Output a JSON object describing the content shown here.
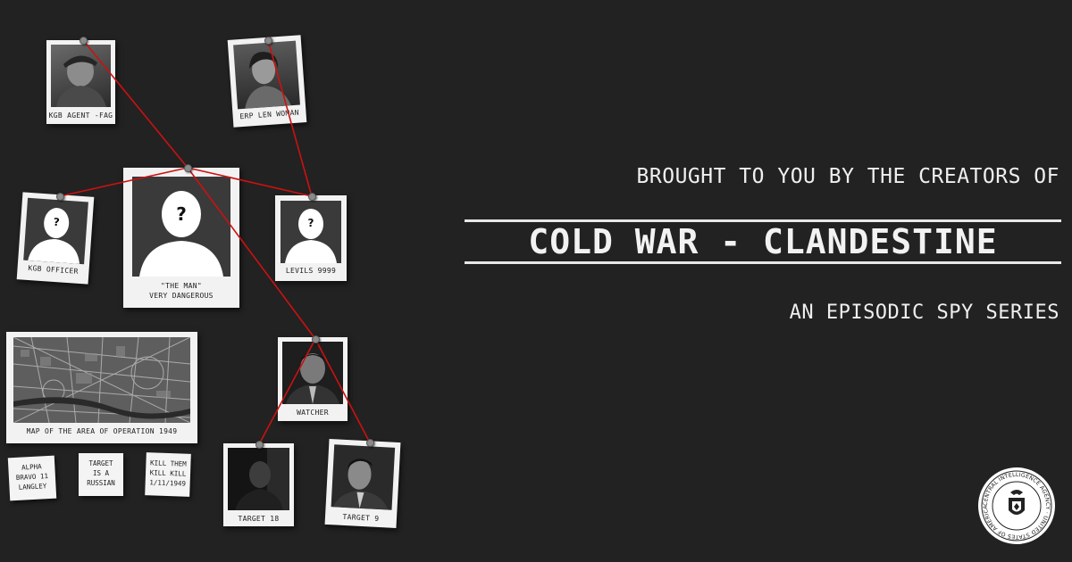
{
  "header": {
    "tagline": "BROUGHT TO YOU BY THE CREATORS OF",
    "title": "COLD WAR - CLANDESTINE",
    "subtitle": "AN EPISODIC SPY SERIES"
  },
  "board": {
    "photos": [
      {
        "id": "kgb-agent",
        "caption": "KGB AGENT -FAG"
      },
      {
        "id": "erp-len",
        "caption": "ERP LEN WOMAN"
      },
      {
        "id": "the-man",
        "caption_line1": "\"THE MAN\"",
        "caption_line2": "VERY DANGEROUS"
      },
      {
        "id": "kgb-officer",
        "caption": "KGB OFFICER"
      },
      {
        "id": "levels",
        "caption": "LEVILS 9999"
      },
      {
        "id": "map",
        "caption": "MAP OF THE AREA OF OPERATION 1949"
      },
      {
        "id": "watcher",
        "caption": "WATCHER"
      },
      {
        "id": "target-18",
        "caption": "TARGET 18"
      },
      {
        "id": "target-9",
        "caption": "TARGET 9"
      }
    ],
    "notes": [
      {
        "line1": "ALPHA",
        "line2": "BRAVO 11",
        "line3": "LANGLEY"
      },
      {
        "line1": "TARGET",
        "line2": "IS A",
        "line3": "RUSSIAN"
      },
      {
        "line1": "KILL THEM",
        "line2": "KILL KILL",
        "line3": "1/11/1949"
      }
    ],
    "unknown_mark": "?"
  },
  "seal": {
    "text": "CENTRAL INTELLIGENCE AGENCY · UNITED STATES OF AMERICA"
  },
  "colors": {
    "background": "#222222",
    "string": "#cc1111",
    "paper": "#f2f2f2"
  }
}
